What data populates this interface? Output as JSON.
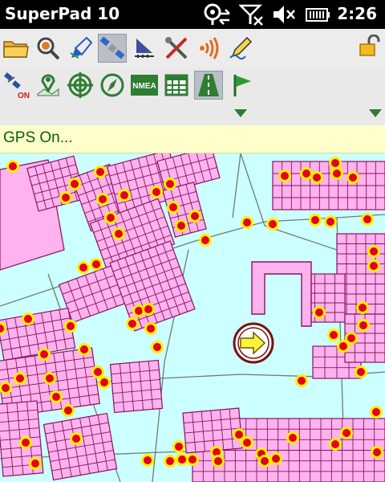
{
  "statusbar": {
    "app_title": "SuperPad 10",
    "clock": "2:26",
    "icons": [
      "gps-sync-icon",
      "signal-off-icon",
      "volume-muted-icon",
      "battery-icon"
    ]
  },
  "toolbar_top": {
    "tools": [
      {
        "name": "open-folder",
        "icon": "folder-icon"
      },
      {
        "name": "zoom",
        "icon": "magnifier-icon"
      },
      {
        "name": "draw",
        "icon": "draw-tool-icon"
      },
      {
        "name": "satellite",
        "icon": "satellite-icon",
        "active": true
      },
      {
        "name": "survey",
        "icon": "survey-instrument-icon"
      },
      {
        "name": "tools",
        "icon": "wrench-screwdriver-icon"
      },
      {
        "name": "signal",
        "icon": "wireless-signal-icon"
      },
      {
        "name": "edit",
        "icon": "pencil-icon"
      },
      {
        "name": "lock",
        "icon": "unlock-icon"
      }
    ]
  },
  "toolbar_gps": {
    "tools": [
      {
        "name": "gps-on",
        "icon": "satellite-on-icon",
        "badge": "ON"
      },
      {
        "name": "gps-map-pin",
        "icon": "map-pin-icon"
      },
      {
        "name": "gps-target",
        "icon": "crosshair-target-icon"
      },
      {
        "name": "gps-compass",
        "icon": "compass-icon"
      },
      {
        "name": "nmea",
        "icon": "nmea-icon",
        "label": "NMEA"
      },
      {
        "name": "gps-log",
        "icon": "calendar-grid-icon"
      },
      {
        "name": "road-nav",
        "icon": "road-icon",
        "active": true
      },
      {
        "name": "waypoint-flag",
        "icon": "green-flag-icon"
      }
    ]
  },
  "status": {
    "text": "GPS On..."
  },
  "map": {
    "background_color": "#ccffff",
    "parcel_color": "#ffb3ee",
    "parcel_edge_color": "#8a1060",
    "point_color": "#ffee00",
    "point_center_color": "#e2001a",
    "gps_marker": {
      "icon": "gps-position-arrow-icon",
      "heading": "east"
    }
  }
}
